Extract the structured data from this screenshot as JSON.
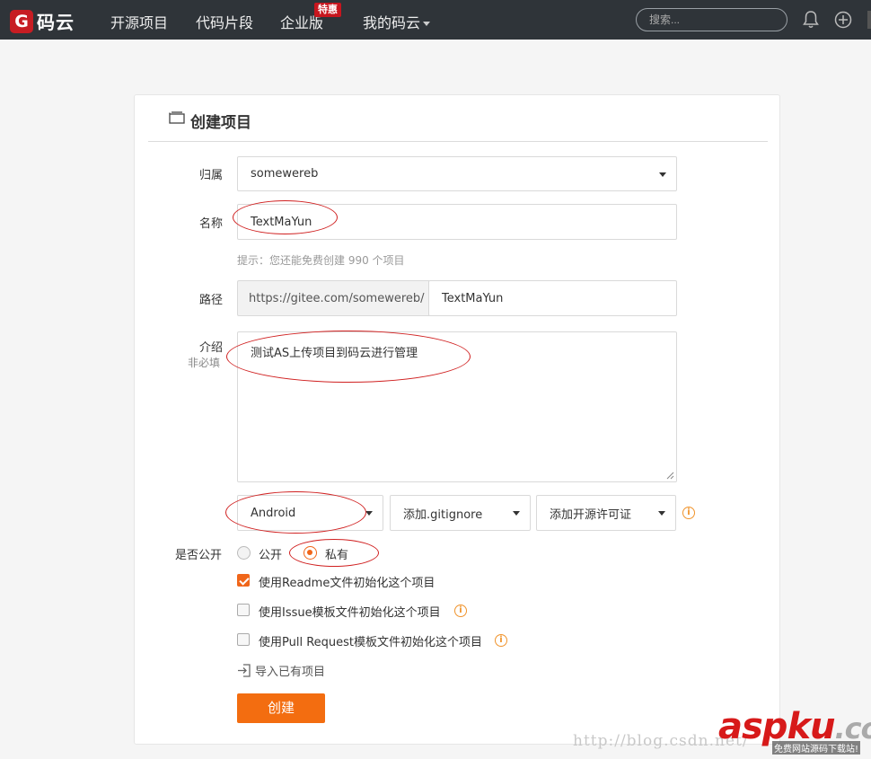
{
  "nav": {
    "logo_mark": "G",
    "logo_text": "码云",
    "items": [
      "开源项目",
      "代码片段",
      "企业版",
      "我的码云"
    ],
    "badge": "特惠",
    "search_placeholder": "搜索..."
  },
  "form": {
    "title": "创建项目",
    "owner_label": "归属",
    "owner_value": "somewereb",
    "name_label": "名称",
    "name_value": "TextMaYun",
    "hint": "提示：您还能免费创建 990 个项目",
    "path_label": "路径",
    "path_prefix": "https://gitee.com/somewereb/",
    "path_value": "TextMaYun",
    "intro_label": "介绍",
    "intro_sublabel": "非必填",
    "intro_value": "测试AS上传项目到码云进行管理",
    "language": "Android",
    "gitignore": "添加.gitignore",
    "license": "添加开源许可证",
    "public_label": "是否公开",
    "radio_public": "公开",
    "radio_private": "私有",
    "check_readme": "使用Readme文件初始化这个项目",
    "check_issue": "使用Issue模板文件初始化这个项目",
    "check_pr": "使用Pull Request模板文件初始化这个项目",
    "import_link": "导入已有项目",
    "create_button": "创建"
  },
  "watermark": {
    "url": "http://blog.csdn.net/",
    "logo_a": "asp",
    "logo_b": "ku",
    "logo_c": ".com",
    "sub": "免费网站源码下载站!"
  },
  "colors": {
    "nav_bg": "#2f3439",
    "accent": "#f36d10",
    "badge": "#c7161e",
    "annotation": "#d02020"
  }
}
